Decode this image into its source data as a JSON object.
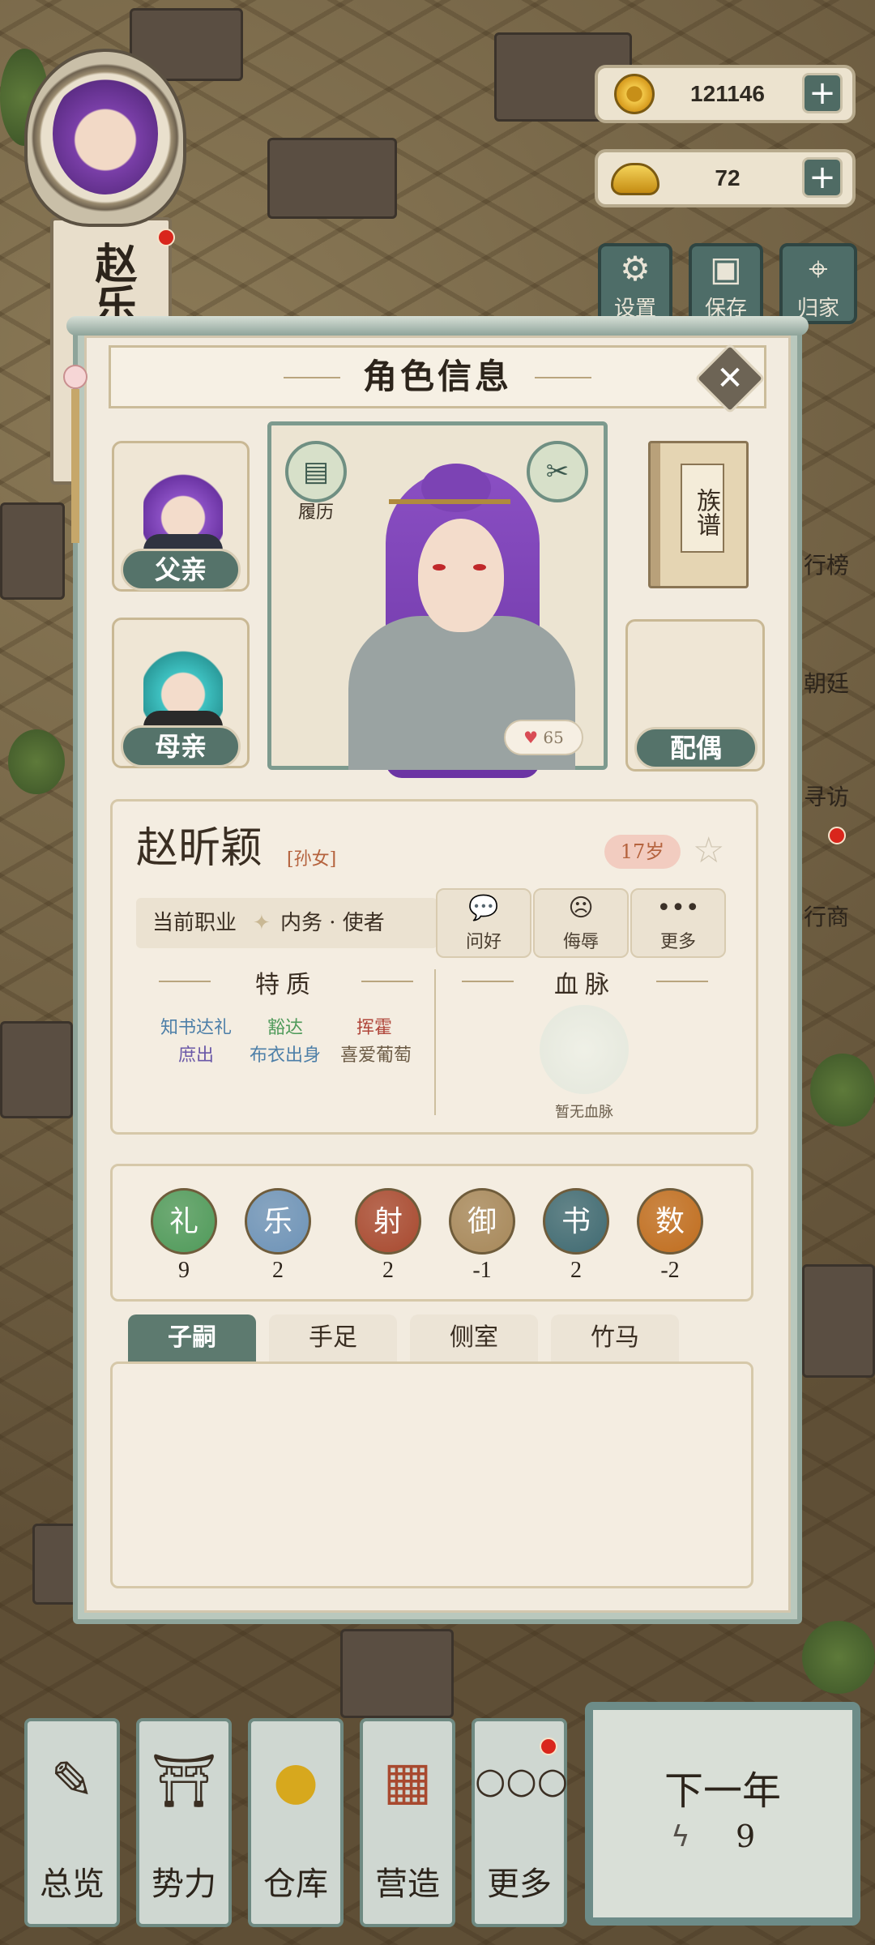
{
  "topleft": {
    "name": "赵乐"
  },
  "currency": {
    "copper": "121146",
    "gold": "72",
    "plus": "+"
  },
  "toolbar": {
    "settings": "设置",
    "save": "保存",
    "home": "归家"
  },
  "side_menu": {
    "ranking": "行榜",
    "court": "朝廷",
    "visit": "寻访",
    "trade": "行商"
  },
  "modal": {
    "title": "角色信息",
    "father": "父亲",
    "mother": "母亲",
    "resume": "履历",
    "genealogy": "族谱",
    "spouse": "配偶",
    "favor": "65",
    "character": {
      "name": "赵昕颖",
      "relation": "[孙女]",
      "age": "17岁",
      "job_label": "当前职业",
      "job_value": "内务 · 使者"
    },
    "actions": {
      "greet": "问好",
      "insult": "侮辱",
      "more": "更多"
    },
    "traits_title": "特质",
    "traits": [
      "知书达礼",
      "豁达",
      "挥霍",
      "庶出",
      "布衣出身",
      "喜爱葡萄"
    ],
    "bloodline_title": "血脉",
    "bloodline_none": "暂无血脉",
    "stats": [
      {
        "label": "礼",
        "value": "9",
        "color": "#4f9a5a"
      },
      {
        "label": "乐",
        "value": "2",
        "color": "#6d93b8"
      },
      {
        "label": "射",
        "value": "2",
        "color": "#a8492f"
      },
      {
        "label": "御",
        "value": "-1",
        "color": "#a7885a"
      },
      {
        "label": "书",
        "value": "2",
        "color": "#3f6a72"
      },
      {
        "label": "数",
        "value": "-2",
        "color": "#c06d1e"
      }
    ],
    "tabs": [
      "子嗣",
      "手足",
      "侧室",
      "竹马"
    ]
  },
  "bottom_nav": {
    "overview": "总览",
    "power": "势力",
    "warehouse": "仓库",
    "build": "营造",
    "more": "更多",
    "next_year": "下一年",
    "energy": "9"
  }
}
